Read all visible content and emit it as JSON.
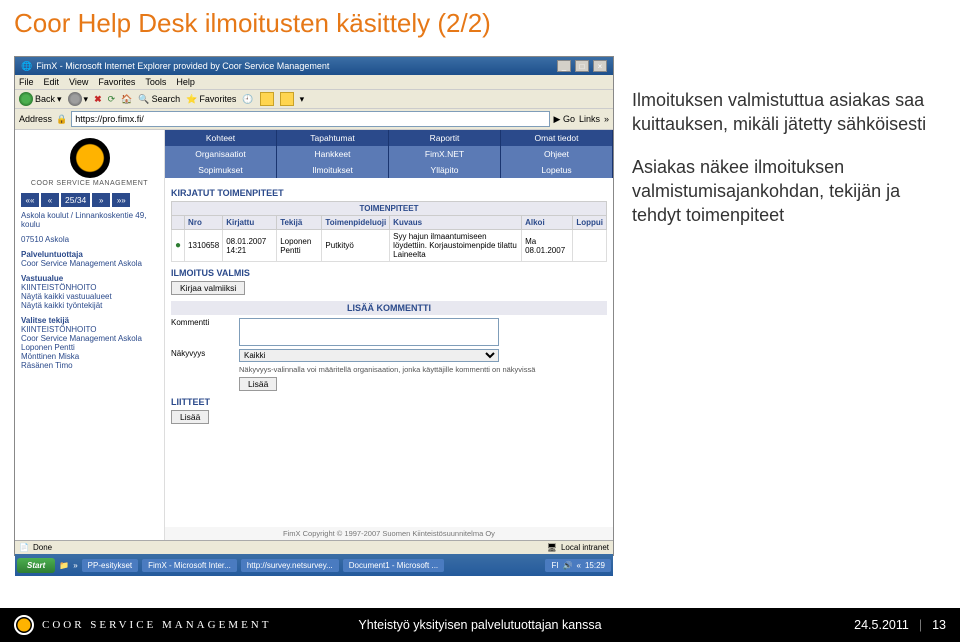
{
  "slide": {
    "title": "Coor Help Desk ilmoitusten käsittely (2/2)"
  },
  "annotations": {
    "p1": "Ilmoituksen valmistuttua asiakas saa kuittauksen, mikäli jätetty sähköisesti",
    "p2": "Asiakas näkee ilmoituksen valmistumisajankohdan, tekijän ja tehdyt toimenpiteet"
  },
  "ie": {
    "title": "FimX - Microsoft Internet Explorer provided by Coor Service Management",
    "menu": [
      "File",
      "Edit",
      "View",
      "Favorites",
      "Tools",
      "Help"
    ],
    "back": "Back",
    "search": "Search",
    "favorites": "Favorites",
    "address_label": "Address",
    "url": "https://pro.fimx.fi/",
    "go": "Go",
    "links": "Links",
    "done": "Done",
    "zone": "Local intranet"
  },
  "sidebar": {
    "brand": "COOR SERVICE MANAGEMENT",
    "pager": "25/34",
    "location_line1": "Askola koulut / Linnankoskentie 49, koulu",
    "location_line2": "07510 Askola",
    "resp_lbl": "Palveluntuottaja",
    "resp_val": "Coor Service Management Askola",
    "area_lbl": "Vastuualue",
    "area_val": "KIINTEISTÖNHOITO",
    "link1": "Näytä kaikki vastuualueet",
    "link2": "Näytä kaikki työntekijät",
    "sel_lbl": "Valitse tekijä",
    "sel_val": "KIINTEISTÖNHOITO",
    "workers": [
      "Coor Service Management Askola",
      "Loponen Pentti",
      "Mönttinen Miska",
      "Räsänen Timo"
    ]
  },
  "nav": {
    "row1": [
      "Kohteet",
      "Tapahtumat",
      "Raportit",
      "Omat tiedot"
    ],
    "row2": [
      "Organisaatiot",
      "Hankkeet",
      "FimX.NET",
      "Ohjeet"
    ],
    "row3": [
      "Sopimukset",
      "Ilmoitukset",
      "Ylläpito",
      "Lopetus"
    ]
  },
  "sections": {
    "kt": "KIRJATUT TOIMENPITEET",
    "tp": "TOIMENPITEET",
    "iv": "ILMOITUS VALMIS",
    "lk": "LISÄÄ KOMMENTTI",
    "li": "LIITTEET"
  },
  "table": {
    "headers": [
      "",
      "Nro",
      "Kirjattu",
      "Tekijä",
      "Toimenpideluoji",
      "Kuvaus",
      "Alkoi",
      "Loppui"
    ],
    "row": {
      "nro": "1310658",
      "kirjattu": "08.01.2007 14:21",
      "tekija": "Loponen Pentti",
      "tpl": "Putkityö",
      "kuvaus": "Syy hajun ilmaantumiseen löydettiin. Korjaustoimenpide tilattu Laineelta",
      "alkoi": "Ma 08.01.2007",
      "loppui": ""
    }
  },
  "form": {
    "btn_valmis": "Kirjaa valmiiksi",
    "kommentti_lbl": "Kommentti",
    "nakyvyys_lbl": "Näkyvyys",
    "nakyvyys_val": "Kaikki",
    "nakyvyys_note": "Näkyvyys-valinnalla voi määritellä organisaation, jonka käyttäjille kommentti on näkyvissä",
    "btn_lisaa": "Lisää"
  },
  "copyright": "FimX Copyright © 1997-2007 Suomen Kiinteistösuunnitelma Oy",
  "taskbar": {
    "start": "Start",
    "items": [
      "PP-esitykset",
      "FimX - Microsoft Inter...",
      "http://survey.netsurvey...",
      "Document1 - Microsoft ..."
    ],
    "lang": "FI",
    "time": "15:29"
  },
  "footer": {
    "brand": "COOR SERVICE MANAGEMENT",
    "center": "Yhteistyö yksityisen palvelutuottajan kanssa",
    "date": "24.5.2011",
    "page": "13"
  }
}
